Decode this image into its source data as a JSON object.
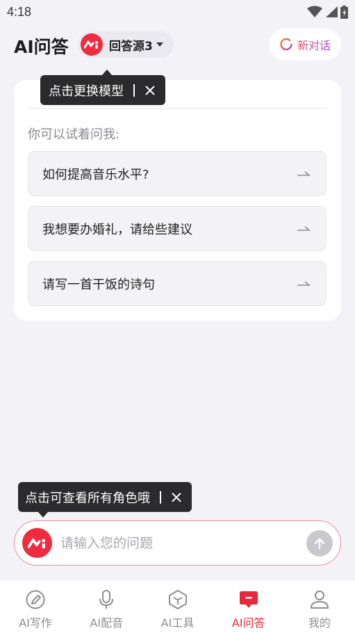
{
  "status_bar": {
    "time": "4:18"
  },
  "header": {
    "title": "AI问答",
    "model_name": "回答源3",
    "new_chat_label": "新对话"
  },
  "tooltips": {
    "model_tip": "点击更换模型",
    "role_tip": "点击可查看所有角色哦"
  },
  "card": {
    "hint": "你可以试着问我:",
    "suggestions": [
      {
        "text": "如何提高音乐水平?"
      },
      {
        "text": "我想要办婚礼，请给些建议"
      },
      {
        "text": "请写一首干饭的诗句"
      }
    ]
  },
  "input": {
    "placeholder": "请输入您的问题",
    "value": ""
  },
  "bottom_nav": {
    "items": [
      {
        "label": "AI写作",
        "icon": "pen-icon"
      },
      {
        "label": "AI配音",
        "icon": "microphone-icon"
      },
      {
        "label": "AI工具",
        "icon": "cube-icon"
      },
      {
        "label": "AI问答",
        "icon": "chat-icon"
      },
      {
        "label": "我的",
        "icon": "user-icon"
      }
    ],
    "active_index": 3
  },
  "colors": {
    "accent": "#e8273a",
    "brand_red": "#ef2b3f",
    "background": "#f3f3f7",
    "tooltip_bg": "#2b2b2d"
  }
}
